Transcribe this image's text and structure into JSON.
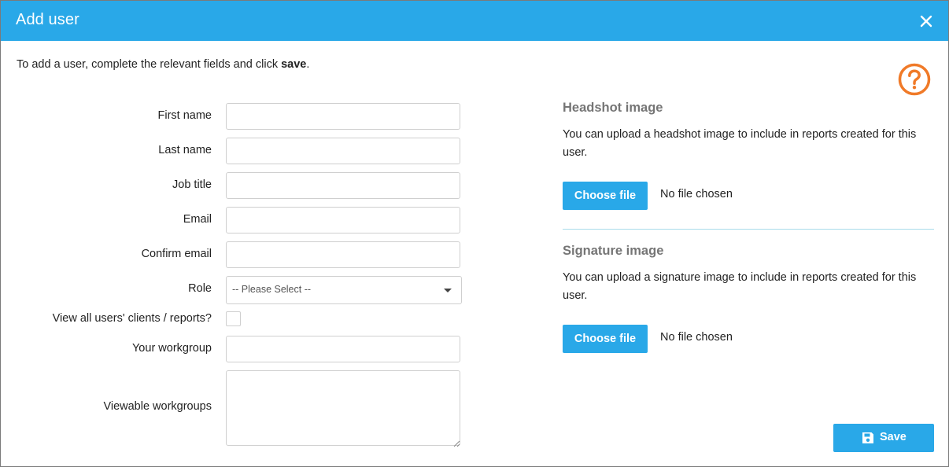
{
  "dialog": {
    "title": "Add user",
    "close_icon": "close-icon",
    "intro_prefix": "To add a user, complete the relevant fields and click ",
    "intro_bold": "save",
    "intro_suffix": ".",
    "help_icon": "question-circle-icon"
  },
  "form": {
    "first_name": {
      "label": "First name",
      "value": ""
    },
    "last_name": {
      "label": "Last name",
      "value": ""
    },
    "job_title": {
      "label": "Job title",
      "value": ""
    },
    "email": {
      "label": "Email",
      "value": ""
    },
    "confirm_email": {
      "label": "Confirm email",
      "value": ""
    },
    "role": {
      "label": "Role",
      "selected": "-- Please Select --"
    },
    "view_all": {
      "label": "View all users' clients / reports?",
      "checked": false
    },
    "your_workgroup": {
      "label": "Your workgroup",
      "value": ""
    },
    "viewable_workgroups": {
      "label": "Viewable workgroups",
      "value": ""
    }
  },
  "headshot": {
    "title": "Headshot image",
    "description": "You can upload a headshot image to include in reports created for this user.",
    "button_label": "Choose file",
    "file_status": "No file chosen"
  },
  "signature": {
    "title": "Signature image",
    "description": "You can upload a signature image to include in reports created for this user.",
    "button_label": "Choose file",
    "file_status": "No file chosen"
  },
  "actions": {
    "save_label": "Save",
    "save_icon": "floppy-disk-icon"
  },
  "colors": {
    "accent": "#29a8e8",
    "help": "#f07a28",
    "section_title": "#757575",
    "divider": "#a9dceb"
  }
}
